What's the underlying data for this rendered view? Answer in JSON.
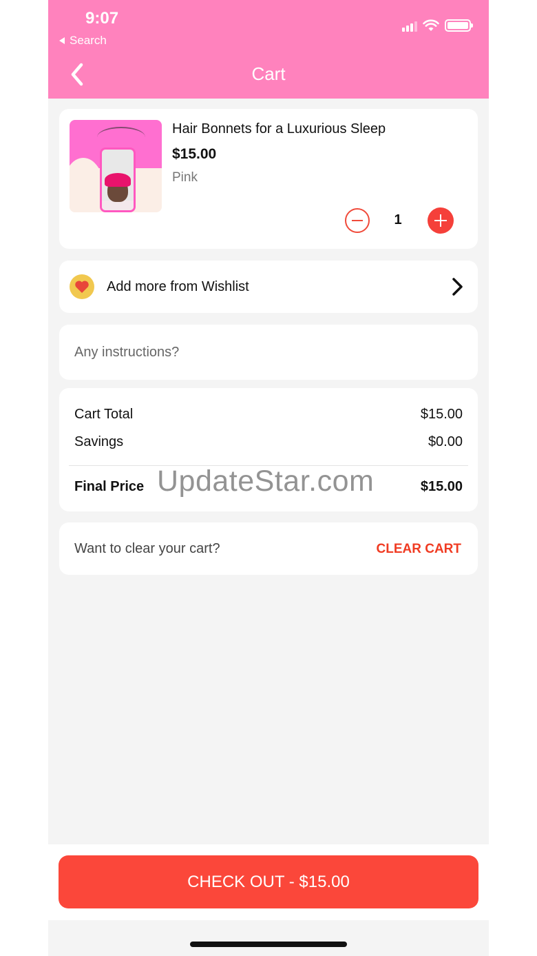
{
  "status_bar": {
    "time": "9:07",
    "back_app": "Search"
  },
  "nav": {
    "title": "Cart"
  },
  "product": {
    "name": "Hair Bonnets for a Luxurious Sleep",
    "price": "$15.00",
    "variant": "Pink",
    "quantity": "1"
  },
  "wishlist": {
    "label": "Add more from Wishlist"
  },
  "instructions": {
    "placeholder": "Any instructions?"
  },
  "totals": {
    "cart_total_label": "Cart Total",
    "cart_total_value": "$15.00",
    "savings_label": "Savings",
    "savings_value": "$0.00",
    "final_label": "Final Price",
    "final_value": "$15.00"
  },
  "clear": {
    "prompt": "Want to clear your cart?",
    "button": "CLEAR CART"
  },
  "checkout": {
    "label": "CHECK OUT - $15.00"
  },
  "watermark": "UpdateStar.com",
  "colors": {
    "header": "#ff82bd",
    "accent": "#fb473a",
    "background": "#f4f4f4"
  },
  "icons": [
    "back-arrow-icon",
    "signal-icon",
    "wifi-icon",
    "battery-icon",
    "minus-icon",
    "plus-icon",
    "heart-icon",
    "chevron-right-icon"
  ]
}
